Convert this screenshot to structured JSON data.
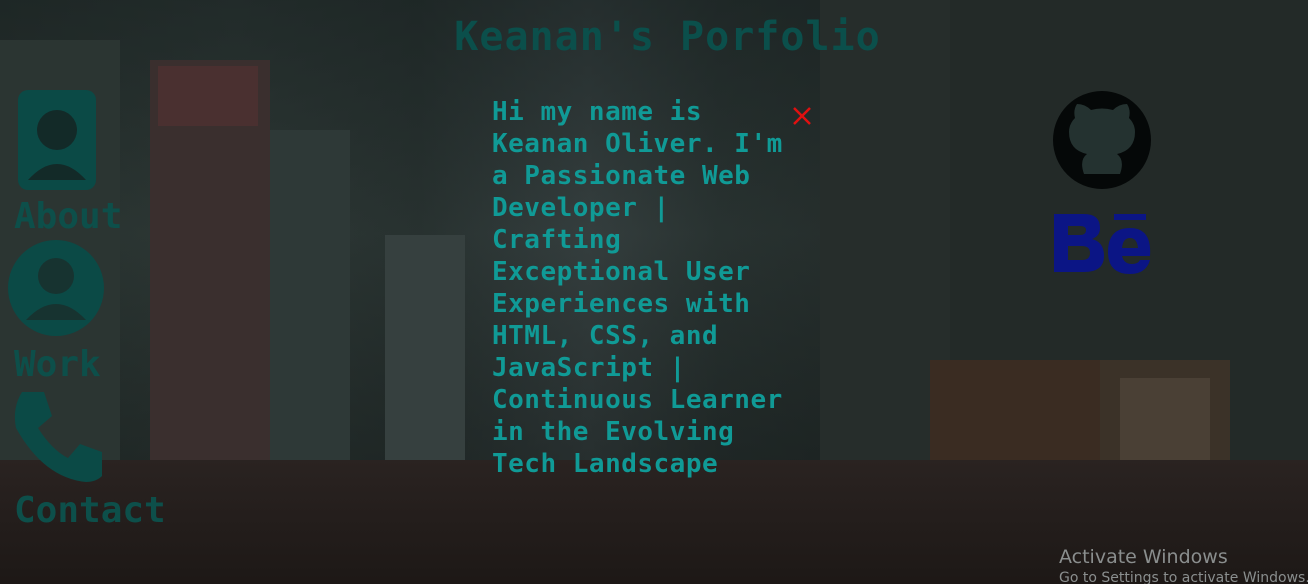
{
  "site": {
    "title": "Keanan's Porfolio"
  },
  "nav": {
    "items": [
      {
        "label": "About",
        "icon": "user-profile-icon"
      },
      {
        "label": "Work",
        "icon": "user-circle-icon"
      },
      {
        "label": "Contact",
        "icon": "phone-icon"
      }
    ]
  },
  "intro": {
    "text": "Hi my name is Keanan Oliver. I'm a Passionate Web Developer | Crafting Exceptional User Experiences with HTML, CSS, and JavaScript | Continuous Learner in the Evolving Tech Landscape"
  },
  "social": {
    "github_icon": "github-icon",
    "behance_icon": "behance-icon"
  },
  "colors": {
    "title": "#0b4f4b",
    "nav": "#0d4f4a",
    "intro_text": "#109a96",
    "close": "#e01010",
    "github": "#050808",
    "behance": "#0b1585",
    "watermark": "#8a8e8e"
  },
  "os_overlay": {
    "title": "Activate Windows",
    "subtitle": "Go to Settings to activate Windows."
  }
}
